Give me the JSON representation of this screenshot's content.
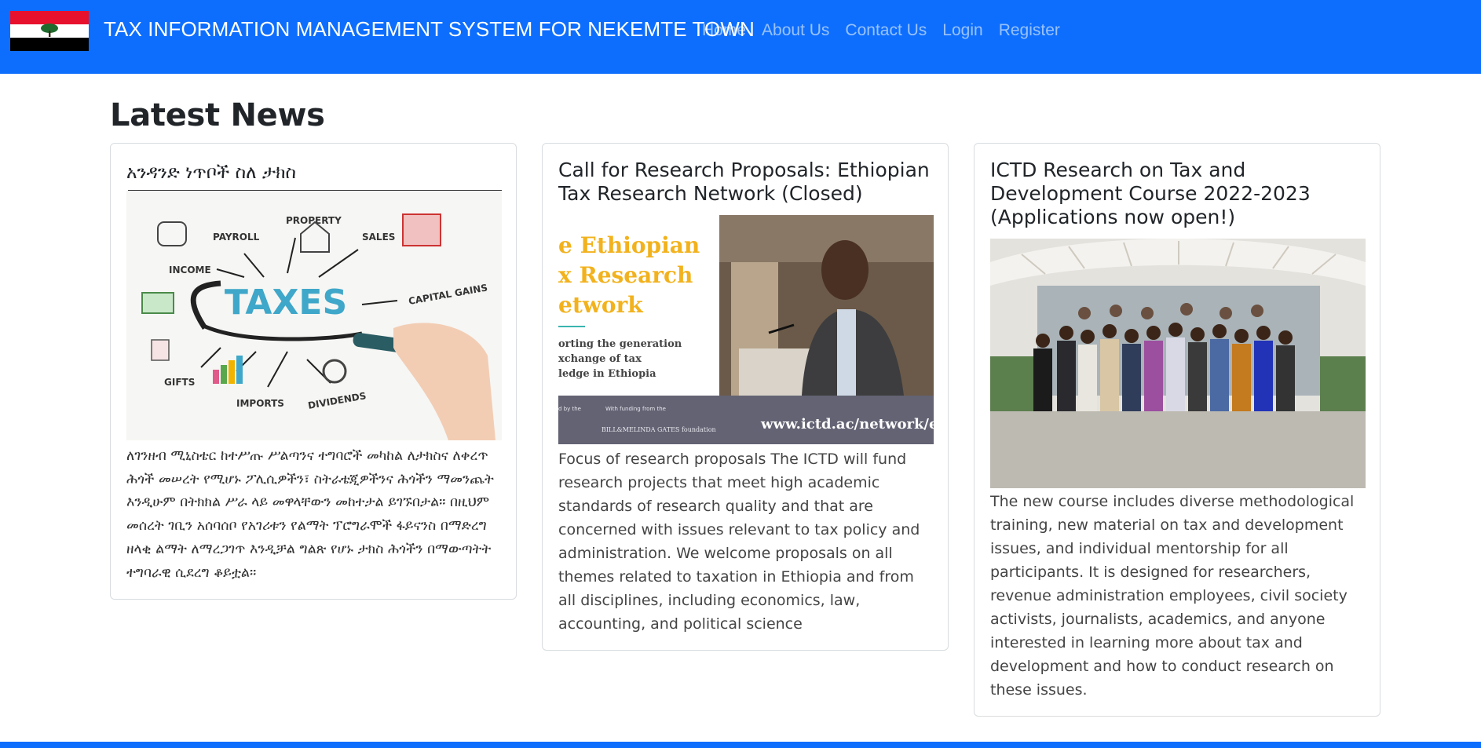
{
  "app": {
    "brand_title": "TAX INFORMATION MANAGEMENT SYSTEM FOR NEKEMTE TOWN",
    "primary_color": "#0d6efd"
  },
  "nav": {
    "items": [
      {
        "label": "Home"
      },
      {
        "label": "About Us"
      },
      {
        "label": "Contact Us"
      },
      {
        "label": "Login"
      },
      {
        "label": "Register"
      }
    ]
  },
  "main": {
    "heading": "Latest News",
    "cards": [
      {
        "title": "አንዳንድ ነጥቦች ስለ ታክስ",
        "image": {
          "center_word": "TAXES",
          "labels": [
            "PAYROLL",
            "PROPERTY",
            "SALES",
            "INCOME",
            "CAPITAL GAINS",
            "GIFTS",
            "IMPORTS",
            "DIVIDENDS"
          ]
        },
        "text": "ለገንዘብ ሚኒስቴር ከተሥጡ ሥልጣንና ተግባሮች መካከል ለታክስና ለቀረጥ ሕጎች መሠረት የሚሆኑ ፖሊሲዎችን፣ ስትራቴጂዎችንና ሕጎችን ማመንጨት እንዲሁም በትክክል ሥራ ላይ መዋላቸውን መከተታል ይገኙበታል፡፡ በዚህም መሰረት ገቢን አሰባሰቦ የአገሪቱን የልማት ፕሮግራሞች ፋይናንስ በማድረግ ዘላቂ ልማት ለማረጋገጥ እንዲቻል ግልጽ የሆኑ ታክስ ሕጎችን በማውጣትት ተግባራዊ ሲደረግ ቆይቷል፡፡"
      },
      {
        "title": "Call for Research Proposals: Ethiopian Tax Research Network (Closed)",
        "image": {
          "headline_lines": [
            "e Ethiopian",
            "x Research",
            "etwork"
          ],
          "sub_lines": [
            "orting the generation",
            "xchange of tax",
            "ledge in Ethiopia"
          ],
          "footer_left": "d by the",
          "footer_funding": "With funding from the",
          "footer_foundation": "BILL&MELINDA GATES foundation",
          "footer_url": "www.ictd.ac/network/e"
        },
        "text": "Focus of research proposals The ICTD will fund research projects that meet high academic standards of research quality and that are concerned with issues relevant to tax policy and administration. We welcome proposals on all themes related to taxation in Ethiopia and from all disciplines, including economics, law, accounting, and political science"
      },
      {
        "title": "ICTD Research on Tax and Development Course 2022-2023 (Applications now open!)",
        "image": {},
        "text": "The new course includes diverse methodological training, new material on tax and development issues, and individual mentorship for all participants. It is designed for researchers, revenue administration employees, civil society activists, journalists, academics, and anyone interested in learning more about tax and development and how to conduct research on these issues."
      }
    ]
  },
  "footer": {}
}
